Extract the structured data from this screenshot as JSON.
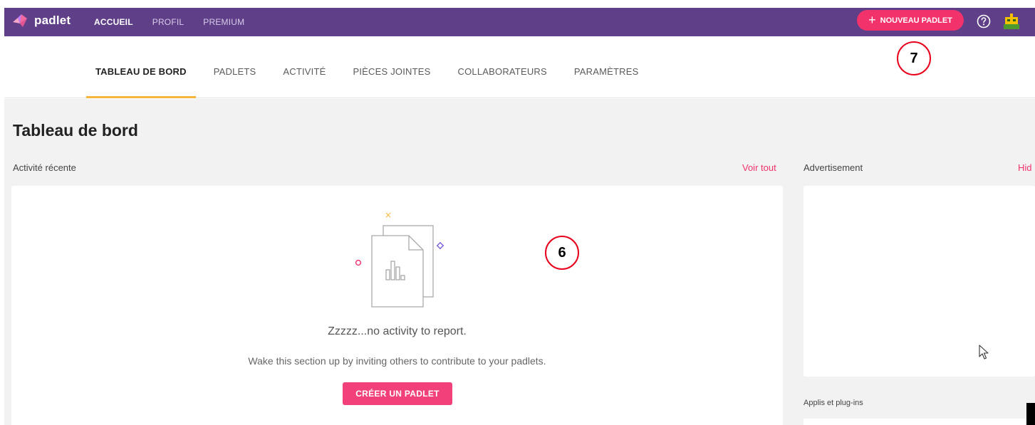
{
  "app": {
    "brand": "padlet"
  },
  "topnav": {
    "items": [
      {
        "label": "ACCUEIL",
        "active": true
      },
      {
        "label": "PROFIL",
        "active": false
      },
      {
        "label": "PREMIUM",
        "active": false
      }
    ],
    "new_padlet_label": "NOUVEAU PADLET",
    "help_icon": "question-circle-icon",
    "avatar_icon": "robot-avatar-icon"
  },
  "tabs": [
    {
      "label": "TABLEAU DE BORD",
      "active": true
    },
    {
      "label": "PADLETS",
      "active": false
    },
    {
      "label": "ACTIVITÉ",
      "active": false
    },
    {
      "label": "PIÈCES JOINTES",
      "active": false
    },
    {
      "label": "COLLABORATEURS",
      "active": false
    },
    {
      "label": "PARAMÈTRES",
      "active": false
    }
  ],
  "main": {
    "title": "Tableau de bord",
    "recent_activity_label": "Activité récente",
    "see_all_label": "Voir tout",
    "ad_label": "Advertisement",
    "ad_hide_label": "Hid",
    "empty_title": "Zzzzz...no activity to report.",
    "empty_subtitle": "Wake this section up by inviting others to contribute to your padlets.",
    "create_button_label": "CRÉER UN PADLET",
    "apps_label": "Applis et plug-ins"
  },
  "annotations": {
    "seven": "7",
    "six": "6"
  },
  "colors": {
    "topbar": "#5f3f87",
    "accent_pink": "#f1326b",
    "tab_underline": "#f5b53d",
    "annotation_red": "#e8001c"
  }
}
